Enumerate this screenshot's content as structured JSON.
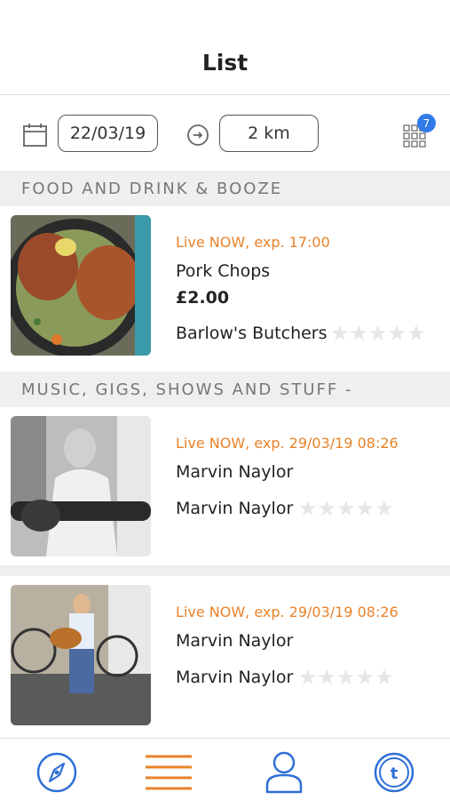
{
  "header": {
    "title": "List"
  },
  "filters": {
    "date": "22/03/19",
    "distance": "2 km",
    "grid_badge": "7"
  },
  "sections": [
    {
      "title": "FOOD AND DRINK & BOOZE",
      "items": [
        {
          "status": "Live NOW, exp. 17:00",
          "title": "Pork Chops",
          "price": "£2.00",
          "seller": "Barlow's Butchers",
          "rating": 0
        }
      ]
    },
    {
      "title": "MUSIC, GIGS, SHOWS AND STUFF -",
      "items": [
        {
          "status": "Live NOW, exp. 29/03/19 08:26",
          "title": "Marvin Naylor",
          "seller": "Marvin Naylor",
          "rating": 0
        },
        {
          "status": "Live NOW, exp. 29/03/19 08:26",
          "title": "Marvin Naylor",
          "seller": "Marvin Naylor",
          "rating": 0
        }
      ]
    }
  ],
  "tabbar": {
    "items": [
      "compass-icon",
      "list-icon",
      "profile-icon",
      "token-icon"
    ],
    "active_color": "#e8822a",
    "icon_color": "#2f6fd6"
  },
  "colors": {
    "accent": "#e8822a",
    "badge": "#2f7be8",
    "section_bg": "#efefef"
  }
}
